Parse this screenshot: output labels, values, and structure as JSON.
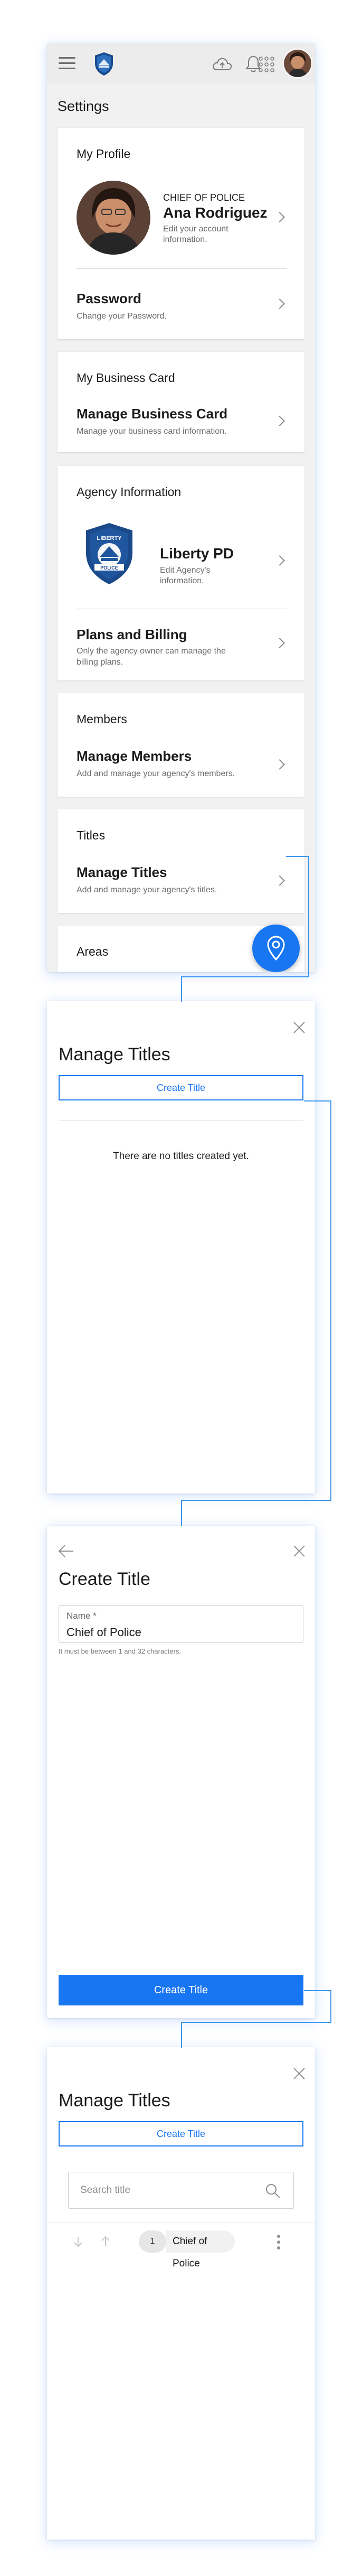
{
  "settings": {
    "page_title": "Settings",
    "profile": {
      "heading": "My Profile",
      "role": "CHIEF OF POLICE",
      "name": "Ana Rodriguez",
      "desc": "Edit your account information.",
      "password_title": "Password",
      "password_desc": "Change your Password."
    },
    "business_card": {
      "heading": "My Business Card",
      "title": "Manage Business Card",
      "desc": "Manage your business card information."
    },
    "agency": {
      "heading": "Agency Information",
      "name": "Liberty PD",
      "desc": "Edit Agency's information.",
      "logo_text": "LIBERTY",
      "logo_sub": "POLICE",
      "plans_title": "Plans and Billing",
      "plans_desc": "Only the agency owner can manage the billing plans."
    },
    "members": {
      "heading": "Members",
      "title": "Manage Members",
      "desc": "Add and manage your agency's members."
    },
    "titles": {
      "heading": "Titles",
      "title": "Manage Titles",
      "desc": "Add and manage your agency's titles."
    },
    "areas": {
      "heading": "Areas"
    }
  },
  "manage_titles_empty": {
    "title": "Manage Titles",
    "create_button": "Create Title",
    "empty_message": "There are no titles created yet."
  },
  "create_title": {
    "title": "Create Title",
    "field_label": "Name *",
    "field_value": "Chief of Police",
    "helper": "It must be between 1 and 32 characters.",
    "submit_button": "Create Title"
  },
  "manage_titles_list": {
    "title": "Manage Titles",
    "create_button": "Create Title",
    "search_placeholder": "Search title",
    "items": [
      {
        "order": "1",
        "name": "Chief of Police"
      }
    ]
  },
  "colors": {
    "accent": "#1976f2",
    "connector": "#3c96ee",
    "background": "#f1f1f1"
  },
  "icons": [
    "menu-icon",
    "agency-badge-icon",
    "cloud-icon",
    "bell-icon",
    "apps-grid-icon",
    "avatar",
    "chevron-right-icon",
    "location-pin-icon",
    "close-icon",
    "back-arrow-icon",
    "search-icon",
    "arrow-down-icon",
    "arrow-up-icon",
    "more-vert-icon"
  ]
}
